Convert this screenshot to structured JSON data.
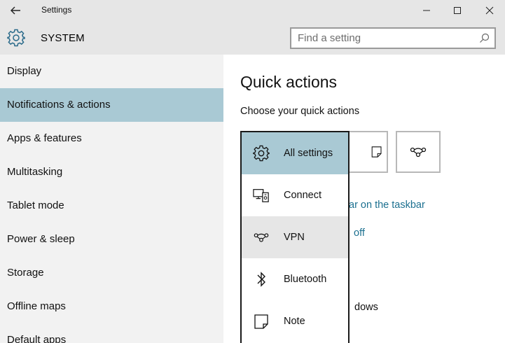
{
  "window": {
    "title": "Settings"
  },
  "header": {
    "section": "SYSTEM",
    "search_placeholder": "Find a setting"
  },
  "sidebar": {
    "items": [
      {
        "label": "Display"
      },
      {
        "label": "Notifications & actions",
        "selected": true
      },
      {
        "label": "Apps & features"
      },
      {
        "label": "Multitasking"
      },
      {
        "label": "Tablet mode"
      },
      {
        "label": "Power & sleep"
      },
      {
        "label": "Storage"
      },
      {
        "label": "Offline maps"
      },
      {
        "label": "Default apps"
      }
    ]
  },
  "main": {
    "title": "Quick actions",
    "subtitle": "Choose your quick actions",
    "link1_partial": "ar on the taskbar",
    "link2_partial": "off",
    "text_partial": "dows"
  },
  "dropdown": {
    "items": [
      {
        "label": "All settings",
        "icon": "gear-icon",
        "state": "selected"
      },
      {
        "label": "Connect",
        "icon": "connect-icon"
      },
      {
        "label": "VPN",
        "icon": "vpn-icon",
        "state": "hover"
      },
      {
        "label": "Bluetooth",
        "icon": "bluetooth-icon"
      },
      {
        "label": "Note",
        "icon": "note-icon"
      }
    ]
  },
  "colors": {
    "selected": "#a9c9d4",
    "chrome": "#e6e6e6",
    "sidebar": "#f2f2f2",
    "link": "#1c7090"
  }
}
